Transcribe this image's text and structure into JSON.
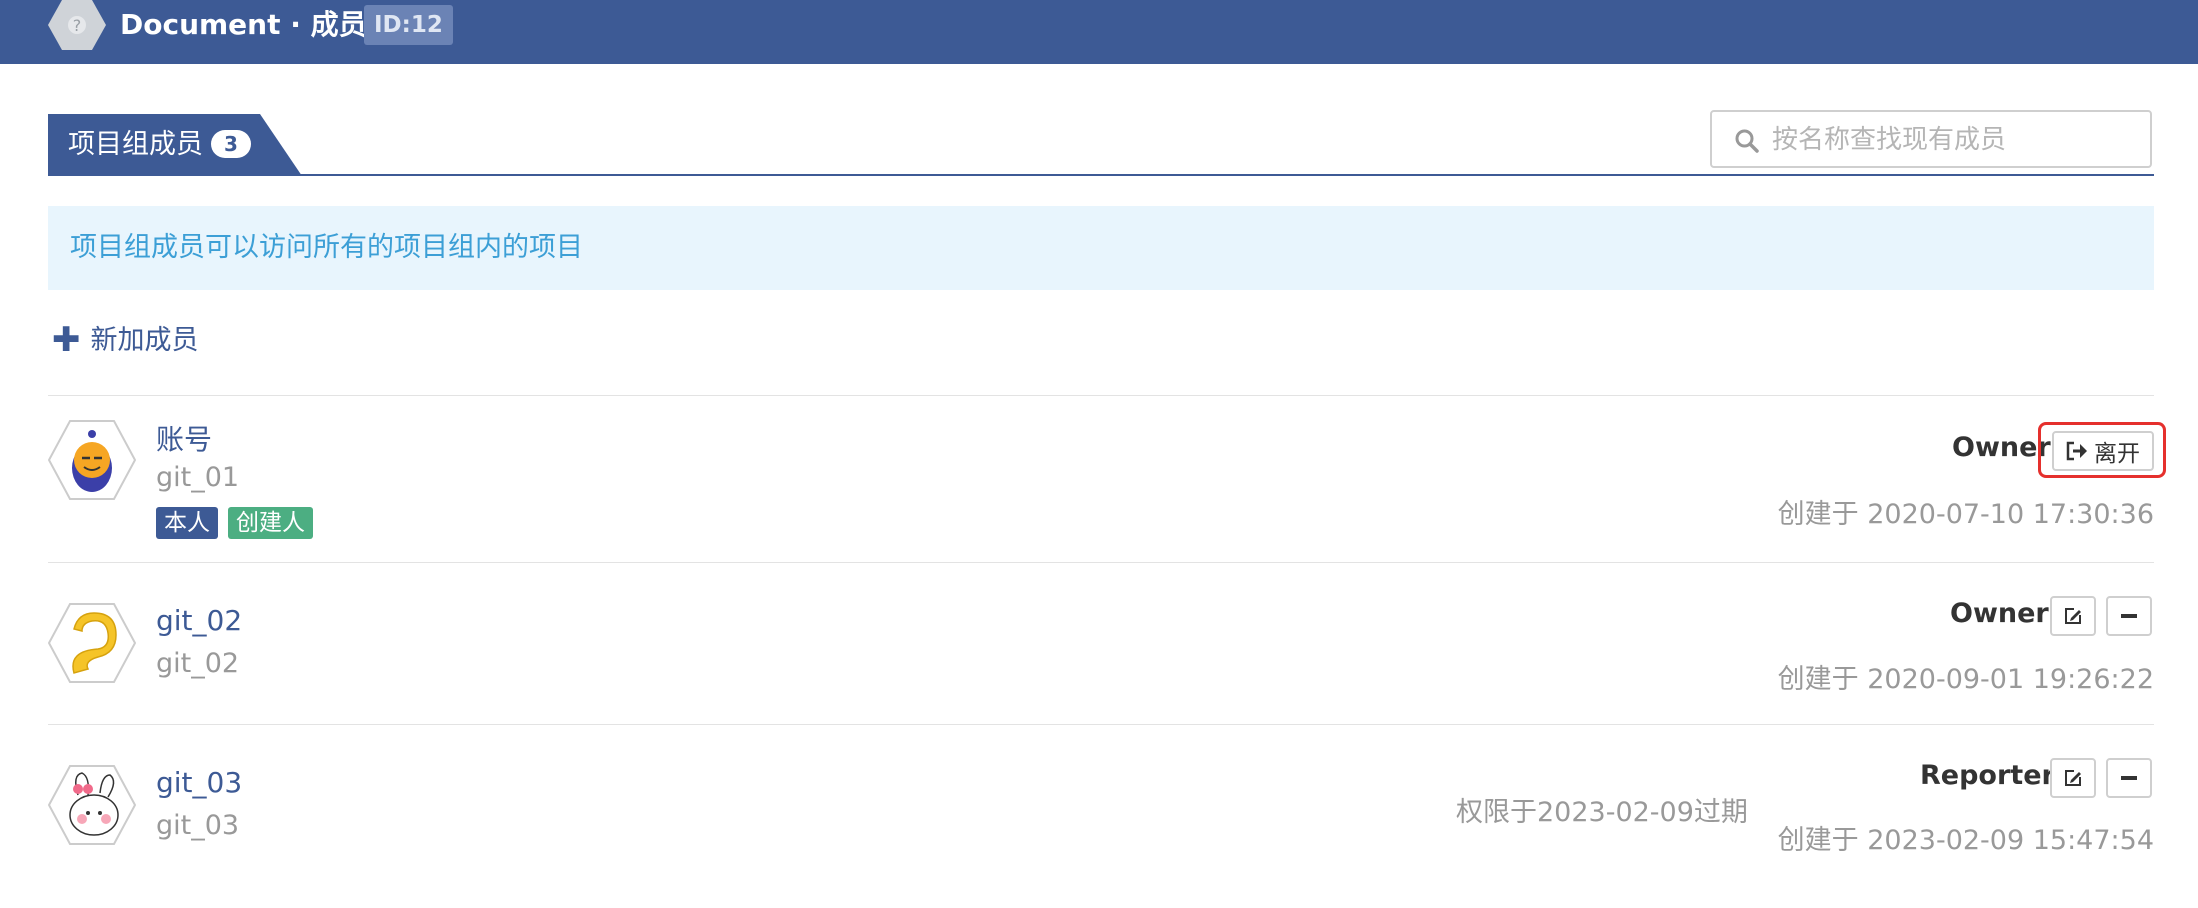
{
  "header": {
    "title": "Document · 成员",
    "id_badge": "ID:12",
    "logo_icon": "project-avatar-icon"
  },
  "tab": {
    "label": "项目组成员",
    "count": "3"
  },
  "search": {
    "placeholder": "按名称查找现有成员",
    "value": ""
  },
  "info_message": "项目组成员可以访问所有的项目组内的项目",
  "add_member_label": "新加成员",
  "members": [
    {
      "name": "账号",
      "login": "git_01",
      "tags": [
        "本人",
        "创建人"
      ],
      "role": "Owner",
      "action_label": "离开",
      "created": "创建于 2020-07-10 17:30:36"
    },
    {
      "name": "git_02",
      "login": "git_02",
      "role": "Owner",
      "created": "创建于 2020-09-01 19:26:22"
    },
    {
      "name": "git_03",
      "login": "git_03",
      "role": "Reporter",
      "expire": "权限于2023-02-09过期",
      "created": "创建于 2023-02-09 15:47:54"
    }
  ],
  "colors": {
    "primary": "#3d5a95",
    "info_bg": "#e8f5fd",
    "info_text": "#3c9fd6",
    "tag_self": "#3d5a95",
    "tag_creator": "#4cae82",
    "highlight": "#e5302d"
  }
}
